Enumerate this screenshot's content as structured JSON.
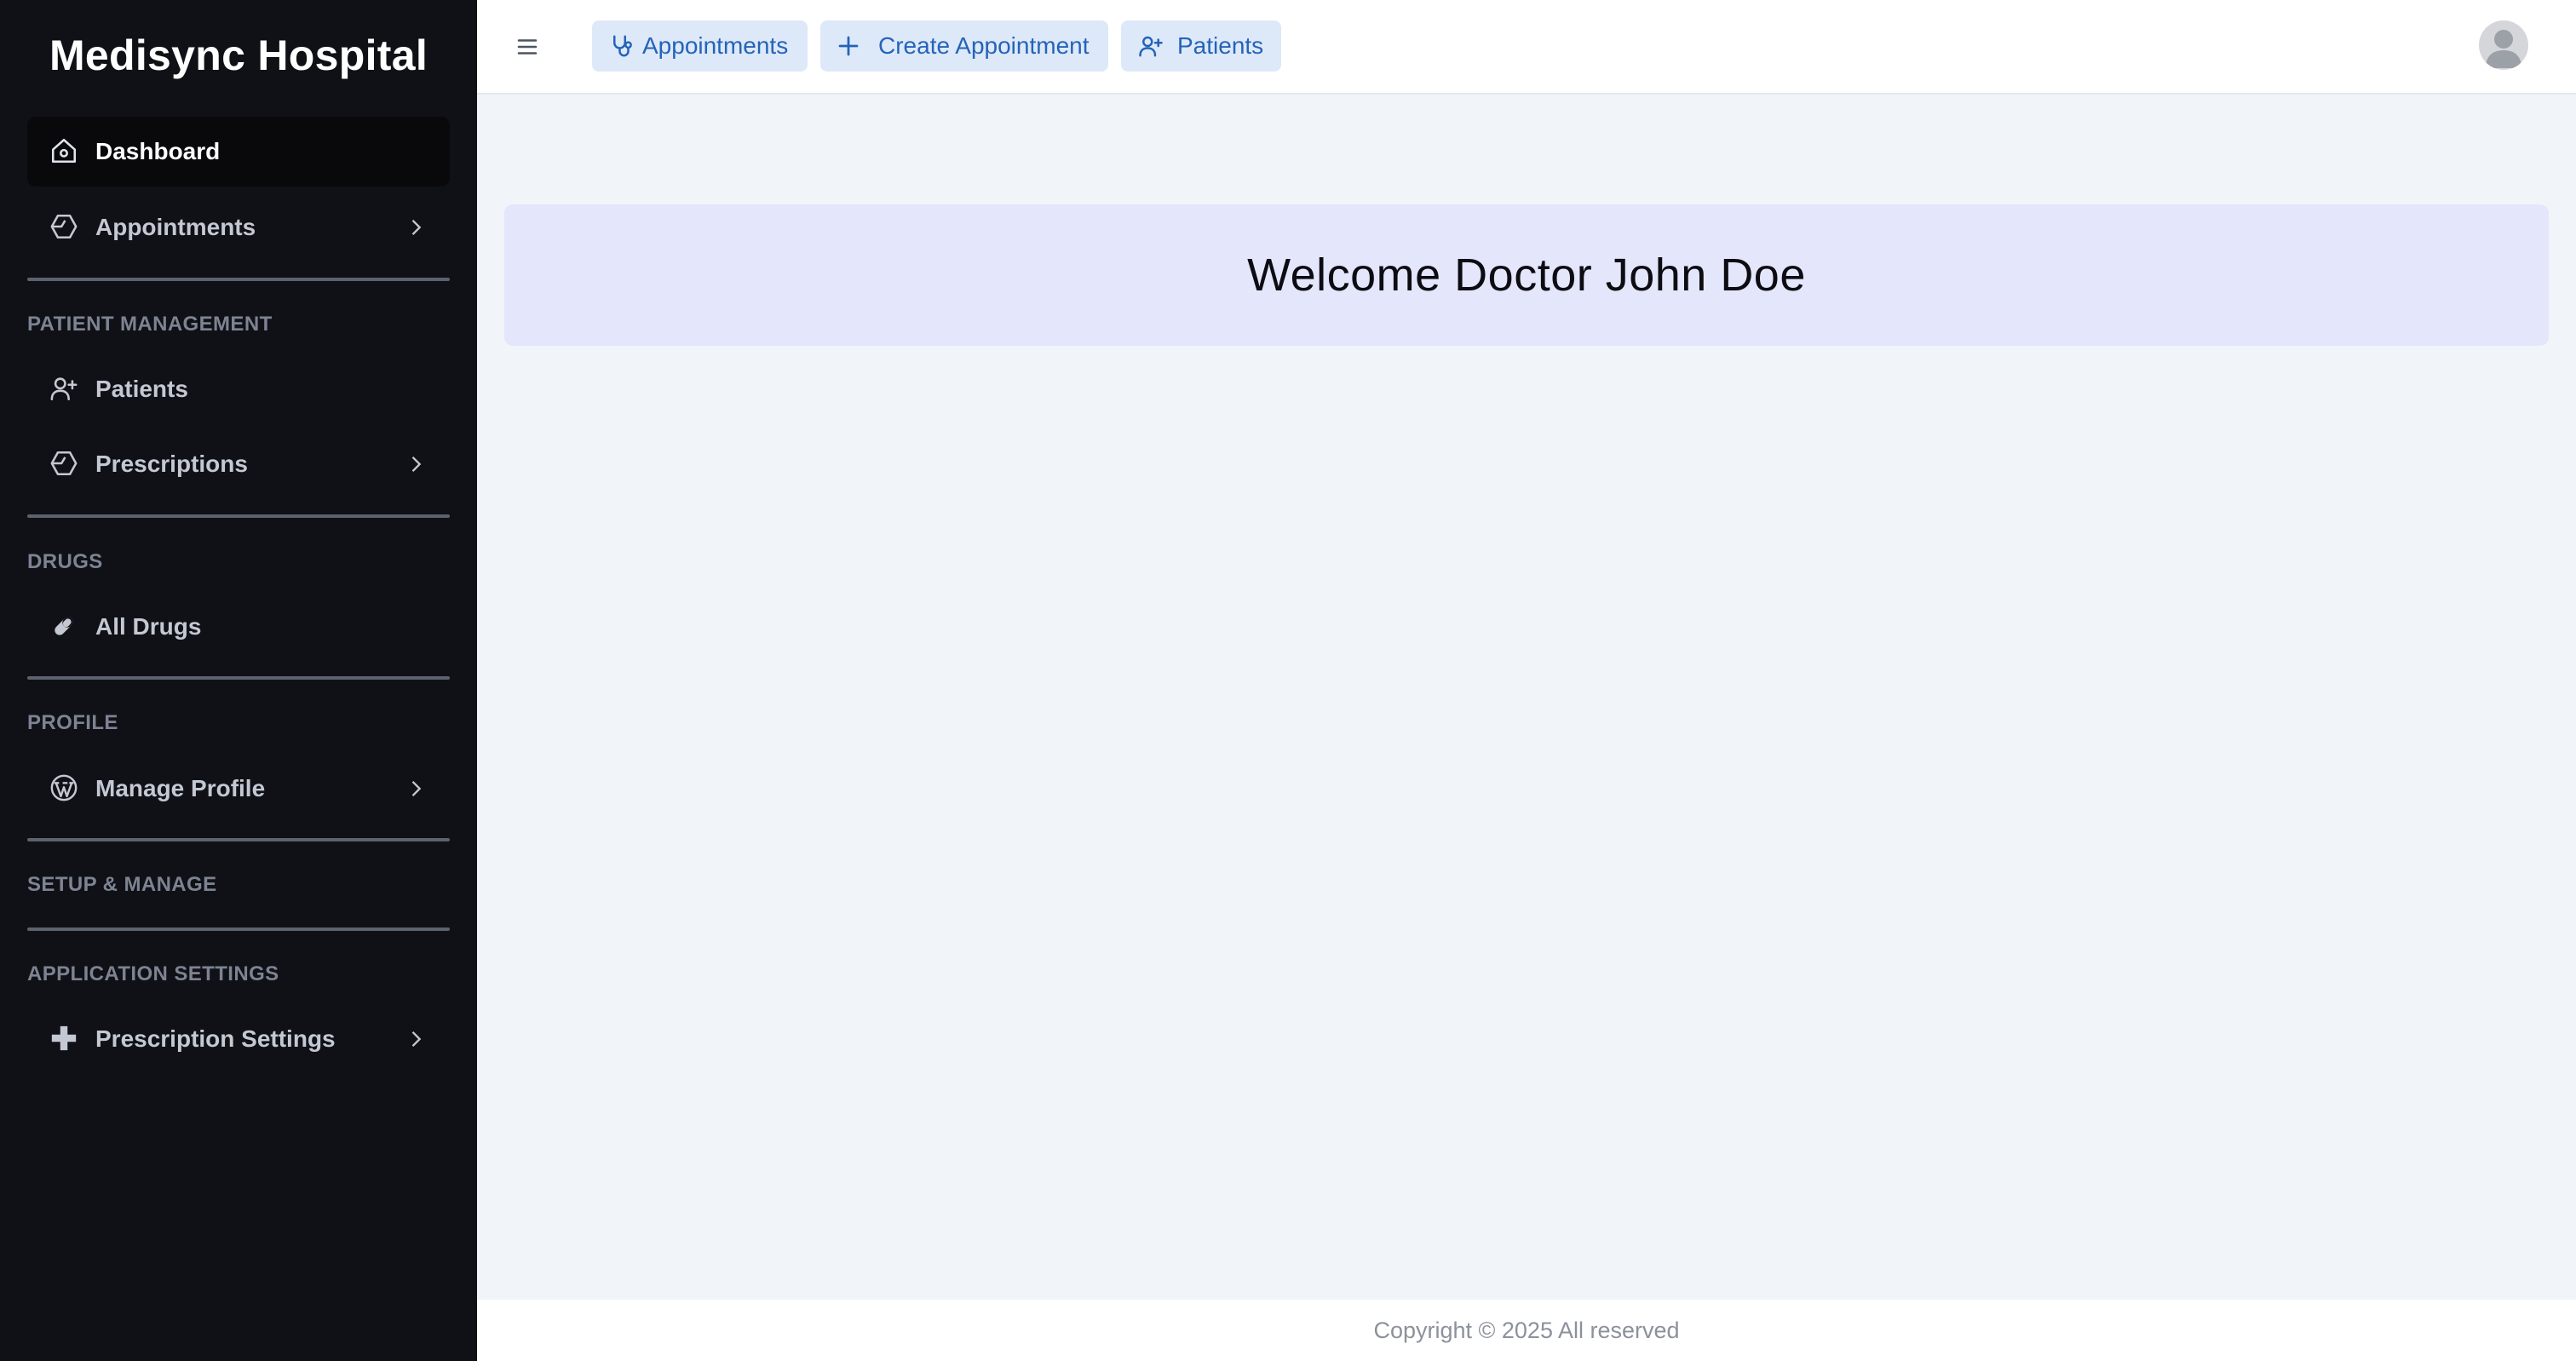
{
  "sidebar": {
    "brand": "Medisync Hospital",
    "items": {
      "dashboard": "Dashboard",
      "appointments": "Appointments",
      "patients": "Patients",
      "prescriptions": "Prescriptions",
      "all_drugs": "All Drugs",
      "manage_profile": "Manage Profile",
      "prescription_settings": "Prescription Settings"
    },
    "sections": {
      "patient_management": "PATIENT MANAGEMENT",
      "drugs": "DRUGS",
      "profile": "PROFILE",
      "setup_manage": "SETUP & MANAGE",
      "application_settings": "APPLICATION SETTINGS"
    }
  },
  "topbar": {
    "appointments_label": "Appointments",
    "create_appointment_label": "Create Appointment",
    "patients_label": "Patients"
  },
  "main": {
    "welcome": "Welcome Doctor John Doe"
  },
  "footer": {
    "copyright": "Copyright © 2025 All reserved"
  },
  "colors": {
    "sidebar_bg": "#0f1116",
    "accent": "#2563b8",
    "quick_button_bg": "#dde9f9",
    "welcome_bg": "#e4e6fb"
  },
  "icons": {
    "dashboard": "home-icon",
    "appointments": "hexagon-icon",
    "patients": "user-plus-icon",
    "prescriptions": "hexagon-icon",
    "all_drugs": "pill-icon",
    "manage_profile": "wordpress-icon",
    "prescription_settings": "medical-cross-icon"
  }
}
